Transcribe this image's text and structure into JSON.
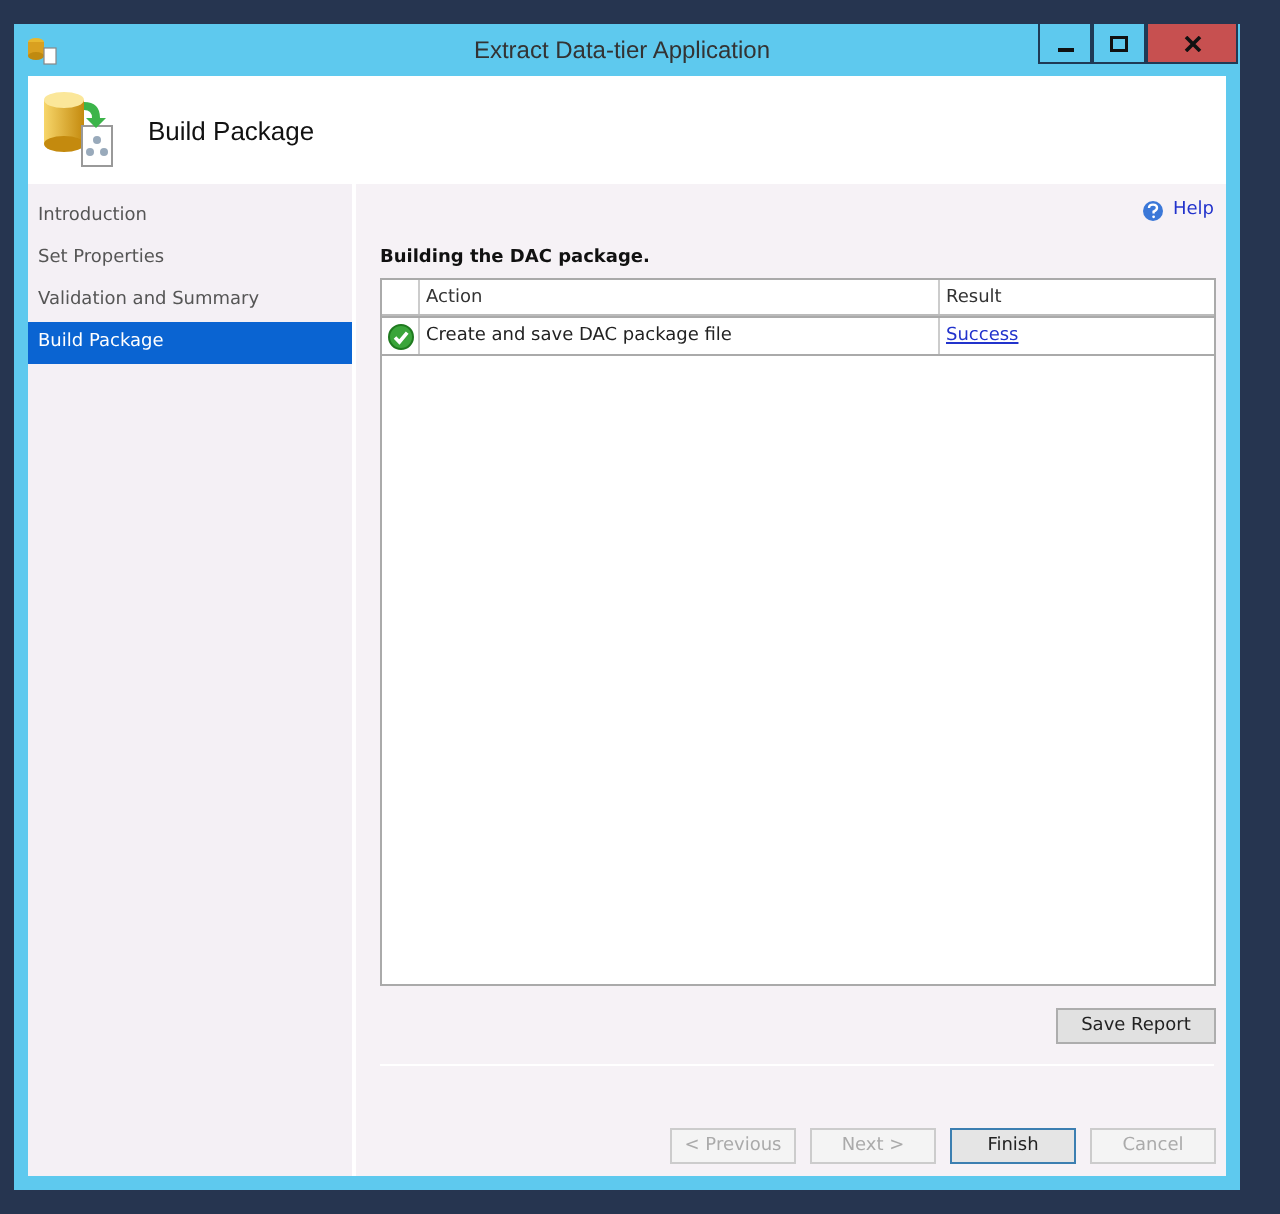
{
  "window": {
    "title": "Extract Data-tier Application"
  },
  "header": {
    "title": "Build Package"
  },
  "sidebar": {
    "items": [
      {
        "label": "Introduction",
        "selected": false
      },
      {
        "label": "Set Properties",
        "selected": false
      },
      {
        "label": "Validation and Summary",
        "selected": false
      },
      {
        "label": "Build Package",
        "selected": true
      }
    ]
  },
  "help": {
    "label": "Help"
  },
  "heading": "Building the DAC package.",
  "table": {
    "columns": [
      "Action",
      "Result"
    ],
    "rows": [
      {
        "kind": "success",
        "action": "Create and save DAC package file",
        "result": "Success"
      }
    ]
  },
  "save_report": {
    "label": "Save Report"
  },
  "buttons": [
    {
      "label": "< Previous",
      "disabled": true,
      "default": false
    },
    {
      "label": "Next >",
      "disabled": true,
      "default": false
    },
    {
      "label": "Finish",
      "disabled": false,
      "default": true
    },
    {
      "label": "Cancel",
      "disabled": true,
      "default": false
    }
  ]
}
